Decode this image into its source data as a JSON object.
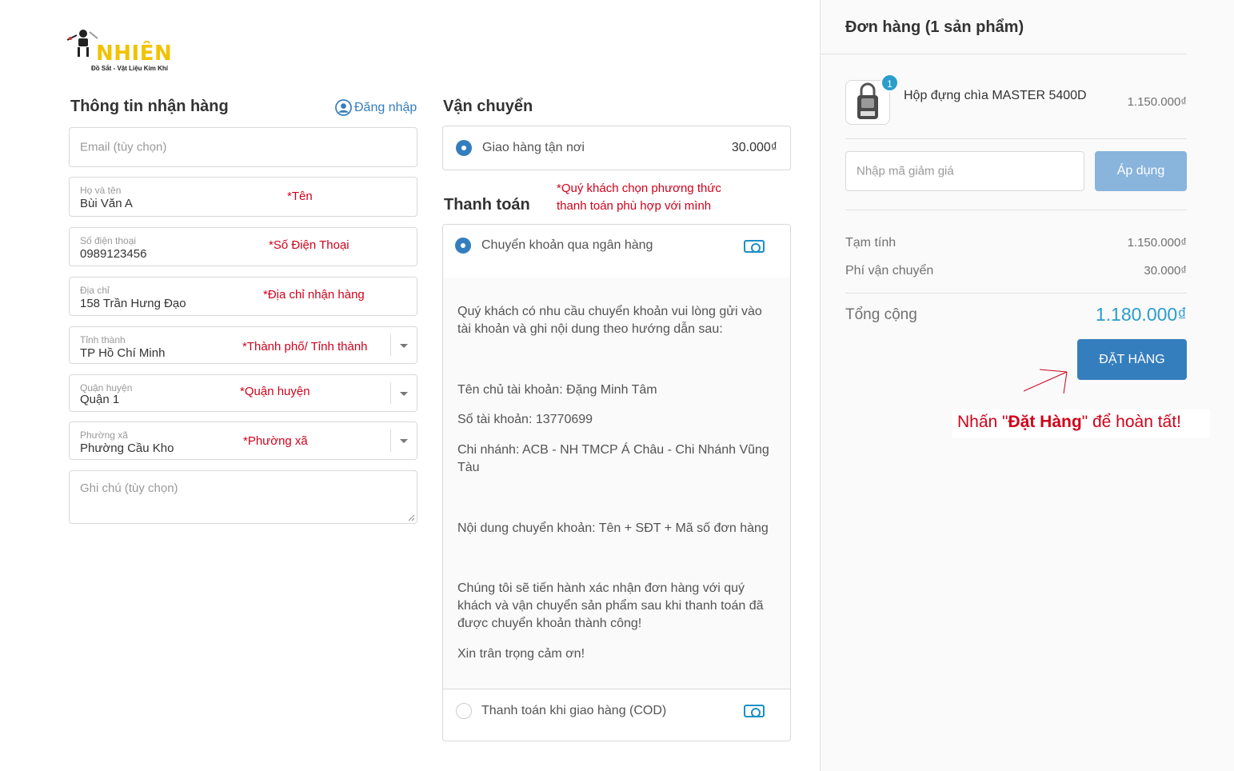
{
  "brand": {
    "name": "NHIÊN",
    "tagline": "Đồ Sắt - Vật Liệu Kim Khí"
  },
  "customer": {
    "title": "Thông tin nhận hàng",
    "login_label": "Đăng nhập",
    "email_placeholder": "Email (tùy chọn)",
    "name": {
      "label": "Họ và tên",
      "value": "Bùi Văn A",
      "note": "*Tên"
    },
    "phone": {
      "label": "Số điện thoại",
      "value": "0989123456",
      "note": "*Số Điện Thoại"
    },
    "address": {
      "label": "Địa chỉ",
      "value": "158 Trần Hưng Đạo",
      "note": "*Địa chỉ nhận hàng"
    },
    "province": {
      "label": "Tỉnh thành",
      "value": "TP Hồ Chí Minh",
      "note": "*Thành phố/ Tỉnh thành"
    },
    "district": {
      "label": "Quận huyện",
      "value": "Quận 1",
      "note": "*Quận huyện"
    },
    "ward": {
      "label": "Phường xã",
      "value": "Phường Cầu Kho",
      "note": "*Phường xã"
    },
    "notes_placeholder": "Ghi chú (tùy chọn)"
  },
  "shipping": {
    "title": "Vận chuyển",
    "option_label": "Giao hàng tận nơi",
    "option_price": "30.000₫"
  },
  "payment": {
    "title": "Thanh toán",
    "note_line1": "*Quý khách chọn phương thức",
    "note_line2": "thanh toán phù hợp với mình",
    "bank_label": "Chuyển khoản qua ngân hàng",
    "bank_info": {
      "intro": "Quý khách có nhu cầu chuyển khoản vui lòng gửi vào tài khoản và ghi nội dung theo hướng dẫn sau:",
      "owner": "Tên chủ tài khoản: Đặng Minh Tâm",
      "account": "Số tài khoản: 13770699",
      "branch": "Chi nhánh: ACB - NH TMCP Á Châu - Chi Nhánh Vũng Tàu",
      "content": "Nội dung chuyển khoản: Tên + SĐT + Mã số đơn hàng",
      "confirm": "Chúng tôi sẽ tiến hành xác nhận đơn hàng với quý khách và vận chuyển sản phẩm sau khi thanh toán đã được chuyển khoản thành công!",
      "thanks": "Xin trân trọng cảm ơn!"
    },
    "cod_label": "Thanh toán khi giao hàng (COD)"
  },
  "order": {
    "title": "Đơn hàng (1 sản phẩm)",
    "product": {
      "name": "Hộp đựng chìa MASTER 5400D",
      "quantity": "1",
      "price": "1.150.000₫"
    },
    "discount_placeholder": "Nhập mã giảm giá",
    "apply_label": "Áp dụng",
    "subtotal_label": "Tạm tính",
    "subtotal_value": "1.150.000₫",
    "shipping_label": "Phí vận chuyển",
    "shipping_value": "30.000₫",
    "total_label": "Tổng cộng",
    "total_value": "1.180.000₫",
    "order_button": "ĐẶT HÀNG",
    "hint_prefix": "Nhấn \"",
    "hint_bold": "Đặt Hàng",
    "hint_suffix": "\" để hoàn tất!"
  },
  "colors": {
    "primary": "#357ebd",
    "total": "#2a9dcc",
    "annotation": "#d0021b",
    "logo": "#f2c200"
  }
}
